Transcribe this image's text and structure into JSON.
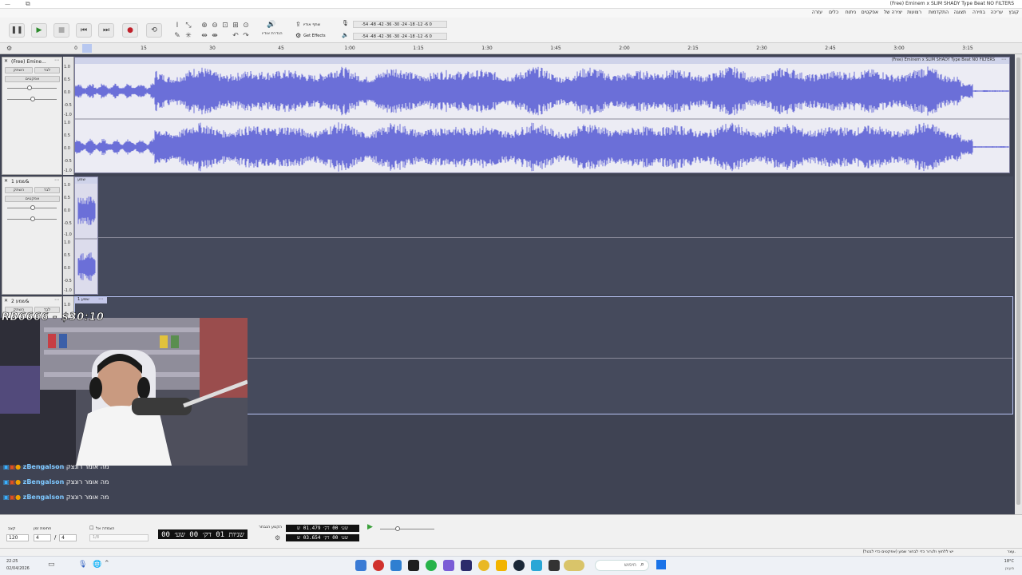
{
  "window": {
    "title": "(Free) Eminem x SLIM SHADY Type Beat  NO FILTERS",
    "menu": [
      "קובץ",
      "עריכה",
      "בחירה",
      "תצוגה",
      "התקדמות",
      "רצועות",
      "יצירה של",
      "אפקטים",
      "ניתוח",
      "כלים",
      "עזרה"
    ]
  },
  "toolbar": {
    "share_audio": "שתף אודיו",
    "get_effects": "Get Effects",
    "audio_setup": "הגדרת אודיו",
    "meter_scale": "-54 -48 -42 -36 -30 -24 -18 -12  -6  0"
  },
  "ruler": {
    "ticks": [
      "0",
      "15",
      "30",
      "45",
      "1:00",
      "1:15",
      "1:30",
      "1:45",
      "2:00",
      "2:15",
      "2:30",
      "2:45",
      "3:00",
      "3:15"
    ]
  },
  "tracks": [
    {
      "name": "(Free) Emine...",
      "mute": "השתק",
      "solo": "לבד",
      "effects": "אפקטים",
      "clip_label": "(Free) Eminem x SLIM SHADY Type Beat  NO FILTERS"
    },
    {
      "name": "שמע 1&",
      "mute": "השתק",
      "solo": "לבד",
      "effects": "אפקטים",
      "clip_label": "שמע"
    },
    {
      "name": "שמע 2&",
      "mute": "השתק",
      "solo": "לבד",
      "clip_label": "שמע 1"
    }
  ],
  "scale_labels": [
    "1.0",
    "0.5",
    "0.0",
    "-0.5",
    "-1.0"
  ],
  "stream": {
    "overlay": "RB6666 - $30:10",
    "chat": [
      {
        "user": "zBengalson",
        "message": "מה אומר רונצק"
      },
      {
        "user": "zBengalson",
        "message": "מה אומר רונצק"
      },
      {
        "user": "zBengalson",
        "message": "מה אומר רונצק"
      }
    ]
  },
  "bottom": {
    "tempo_label": "קצב",
    "tempo_value": "120",
    "timesig_label": "חתימת זמן",
    "timesig_num": "4",
    "timesig_den": "4",
    "snap_label": "הצמדה אל",
    "snap_value": "1/8",
    "time_display": "שניות 01 דק׳ 00 שע׳ 00",
    "selection_label": "הקטע הנבחר",
    "sel_start": "שע׳ 00 דק׳ 01.479 ש",
    "sel_end": "שע׳ 00 דק׳ 03.654 ש"
  },
  "status": {
    "left": "עצר.",
    "hint": "יש ללחוץ ולגרור כדי לבחור שמע (אפקטים כדי לבטל)"
  },
  "taskbar": {
    "search": "חיפוש",
    "time": "22:25",
    "date": "02/04/2026",
    "weather": "18°C",
    "weather_desc": "מעונן"
  }
}
